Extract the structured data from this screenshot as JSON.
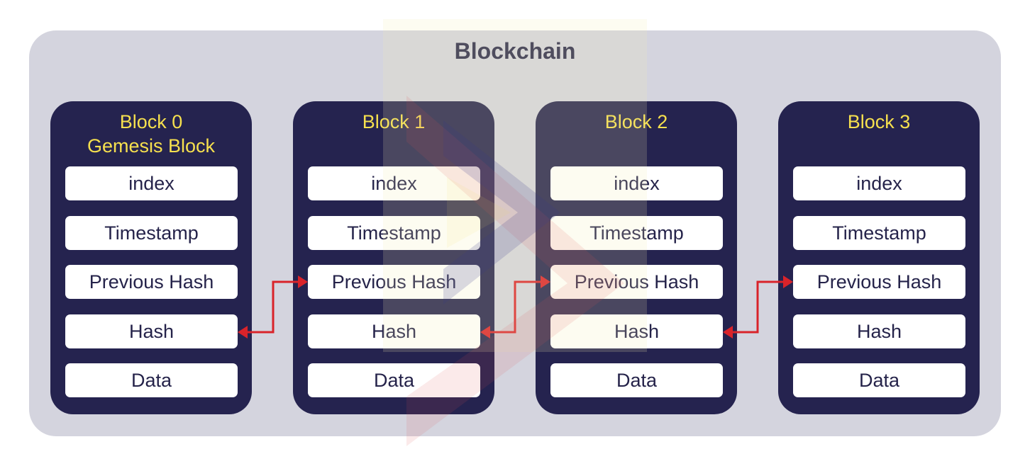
{
  "title": "Blockchain",
  "colors": {
    "container_bg": "#d4d4de",
    "block_bg": "#25234f",
    "block_title": "#f6e04e",
    "field_bg": "#ffffff",
    "field_text": "#25234a",
    "arrow": "#d9232a"
  },
  "blocks": [
    {
      "title": "Block 0",
      "subtitle": "Gemesis Block",
      "fields": [
        "index",
        "Timestamp",
        "Previous Hash",
        "Hash",
        "Data"
      ]
    },
    {
      "title": "Block 1",
      "subtitle": "",
      "fields": [
        "index",
        "Timestamp",
        "Previous Hash",
        "Hash",
        "Data"
      ]
    },
    {
      "title": "Block 2",
      "subtitle": "",
      "fields": [
        "index",
        "Timestamp",
        "Previous Hash",
        "Hash",
        "Data"
      ]
    },
    {
      "title": "Block 3",
      "subtitle": "",
      "fields": [
        "index",
        "Timestamp",
        "Previous Hash",
        "Hash",
        "Data"
      ]
    }
  ],
  "links": [
    {
      "from_block": 0,
      "from_field": "Hash",
      "to_block": 1,
      "to_field": "Previous Hash",
      "bidirectional": true
    },
    {
      "from_block": 1,
      "from_field": "Hash",
      "to_block": 2,
      "to_field": "Previous Hash",
      "bidirectional": true
    },
    {
      "from_block": 2,
      "from_field": "Hash",
      "to_block": 3,
      "to_field": "Previous Hash",
      "bidirectional": true
    }
  ]
}
